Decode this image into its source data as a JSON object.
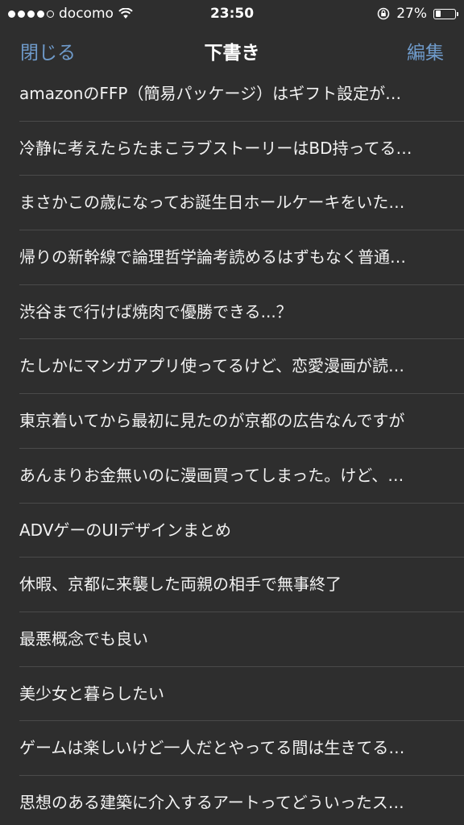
{
  "status": {
    "carrier": "docomo",
    "time": "23:50",
    "battery_percent": "27%",
    "battery_level": 0.27
  },
  "nav": {
    "left_label": "閉じる",
    "title": "下書き",
    "right_label": "編集"
  },
  "drafts": [
    "amazonのFFP（簡易パッケージ）はギフト設定が…",
    "冷静に考えたらたまこラブストーリーはBD持ってる…",
    "まさかこの歳になってお誕生日ホールケーキをいた…",
    "帰りの新幹線で論理哲学論考読めるはずもなく普通…",
    "渋谷まで行けば焼肉で優勝できる...？",
    "たしかにマンガアプリ使ってるけど、恋愛漫画が読…",
    "東京着いてから最初に見たのが京都の広告なんですが",
    "あんまりお金無いのに漫画買ってしまった。けど、…",
    "ADVゲーのUIデザインまとめ",
    "休暇、京都に来襲した両親の相手で無事終了",
    "最悪概念でも良い",
    "美少女と暮らしたい",
    "ゲームは楽しいけど一人だとやってる間は生きてる…",
    "思想のある建築に介入するアートってどういったス…"
  ],
  "colors": {
    "background": "#2e2e2e",
    "accent": "#6f9bcb",
    "separator": "#4a4a4a"
  }
}
